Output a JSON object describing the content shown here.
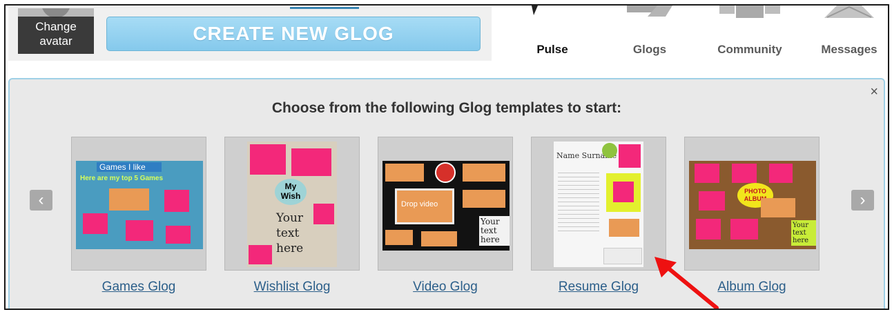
{
  "header": {
    "change_avatar_line1": "Change",
    "change_avatar_line2": "avatar",
    "create_button": "CREATE NEW GLOG"
  },
  "nav": {
    "items": [
      {
        "label": "Pulse",
        "active": true
      },
      {
        "label": "Glogs",
        "active": false
      },
      {
        "label": "Community",
        "active": false
      },
      {
        "label": "Messages",
        "active": false
      }
    ]
  },
  "templates_panel": {
    "title": "Choose from the following Glog templates to start:",
    "close": "×",
    "prev": "‹",
    "next": "›",
    "items": [
      {
        "label": "Games Glog",
        "thumb_text": "Games I like",
        "subtitle": "Here are my top 5 Games"
      },
      {
        "label": "Wishlist Glog",
        "thumb_text": "My Wish",
        "hand": "Your text here"
      },
      {
        "label": "Video Glog",
        "thumb_text": "Drop video",
        "hand": "Your text here"
      },
      {
        "label": "Resume Glog",
        "thumb_text": "Name Surname"
      },
      {
        "label": "Album Glog",
        "thumb_text": "PHOTO ALBUM",
        "hand": "Your text here"
      }
    ]
  },
  "colors": {
    "accent_blue": "#85c9ec",
    "panel_border": "#9fd0e6",
    "link": "#2c5f8a",
    "annotation_arrow": "#ee1111"
  }
}
